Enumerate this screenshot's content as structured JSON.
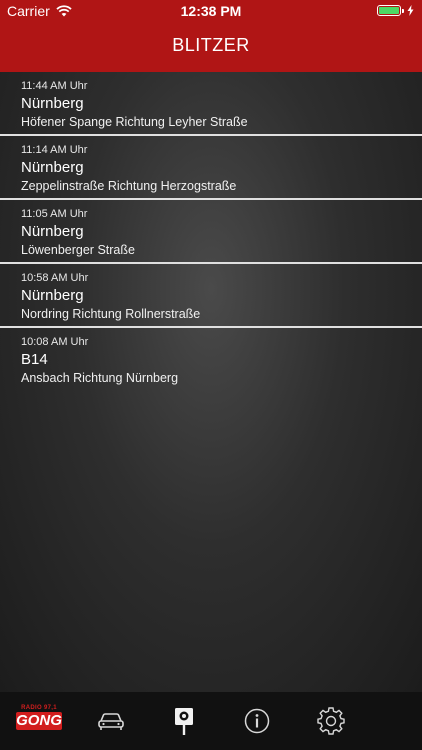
{
  "status_bar": {
    "carrier": "Carrier",
    "time": "12:38 PM"
  },
  "nav": {
    "title": "BLITZER"
  },
  "items": [
    {
      "time": "11:44 AM Uhr",
      "city": "Nürnberg",
      "street": "Höfener Spange Richtung Leyher Straße"
    },
    {
      "time": "11:14 AM Uhr",
      "city": "Nürnberg",
      "street": "Zeppelinstraße Richtung Herzogstraße"
    },
    {
      "time": "11:05 AM Uhr",
      "city": "Nürnberg",
      "street": "Löwenberger Straße"
    },
    {
      "time": "10:58 AM Uhr",
      "city": "Nürnberg",
      "street": "Nordring Richtung Rollnerstraße"
    },
    {
      "time": "10:08 AM Uhr",
      "city": "B14",
      "street": "Ansbach Richtung Nürnberg"
    }
  ],
  "tabbar": {
    "logo_top": "RADIO 97,1",
    "logo_main": "GONG",
    "tabs": [
      {
        "icon": "car-icon"
      },
      {
        "icon": "speed-camera-icon"
      },
      {
        "icon": "info-icon"
      },
      {
        "icon": "gear-icon"
      }
    ]
  },
  "colors": {
    "header": "#b01515",
    "tabbar": "#111111",
    "battery": "#4cd964"
  }
}
